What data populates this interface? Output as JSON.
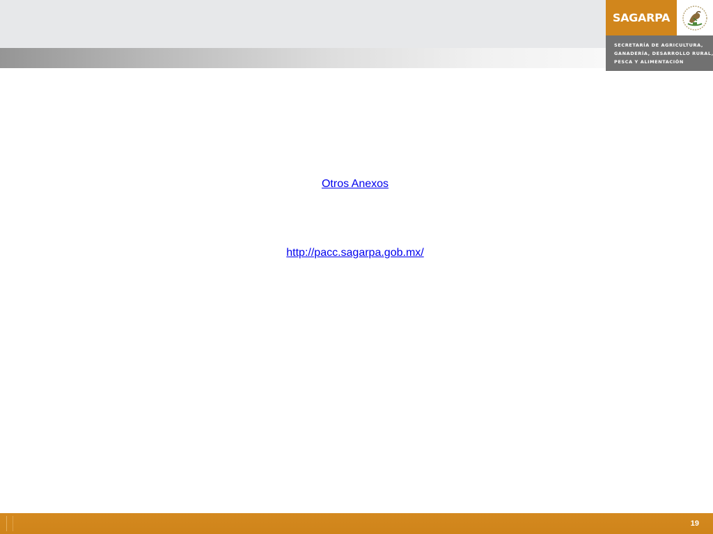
{
  "header": {
    "brand": {
      "wordmark": "SAGARPA",
      "subtitle_lines": [
        "SECRETARÍA DE AGRICULTURA,",
        "GANADERÍA, DESARROLLO RURAL,",
        "PESCA Y ALIMENTACIÓN"
      ],
      "seal_icon": "mexican-coat-of-arms-icon"
    },
    "colors": {
      "top_bar": "#e7e8ea",
      "brand_orange": "#d1861c",
      "brand_gray": "#717171"
    }
  },
  "content": {
    "links": [
      {
        "label": "Otros Anexos"
      },
      {
        "label": "http://pacc.sagarpa.gob.mx/"
      }
    ],
    "link_color": "#0000ee"
  },
  "footer": {
    "page_number": "19",
    "color": "#d1861c"
  }
}
